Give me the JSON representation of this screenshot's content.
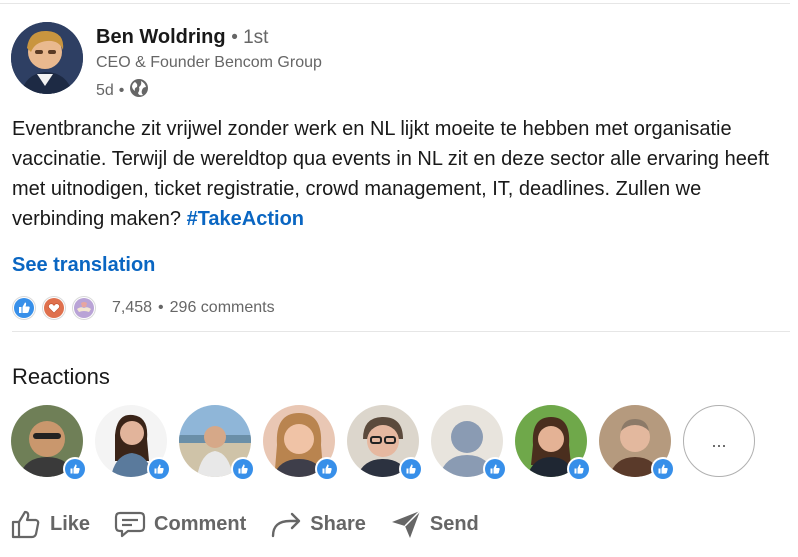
{
  "post": {
    "author_name": "Ben Woldring",
    "degree": "• 1st",
    "headline": "CEO & Founder Bencom Group",
    "age": "5d",
    "visibility_separator": "•",
    "visibility_icon": "globe-icon",
    "text": "Eventbranche zit vrijwel zonder werk en NL lijkt moeite te hebben met organisatie vaccinatie. Terwijl de wereldtop qua events in NL zit en deze sector alle ervaring heeft met uitnodigen, ticket registratie, crowd management, IT, deadlines. Zullen we verbinding maken?",
    "hashtag": "#TakeAction",
    "see_translation": "See translation"
  },
  "social": {
    "reaction_icons": [
      "like-icon",
      "love-icon",
      "support-icon"
    ],
    "reaction_count": "7,458",
    "separator": "•",
    "comments": "296 comments"
  },
  "reactions": {
    "title": "Reactions",
    "people": [
      {
        "name": "reactor-1",
        "badge": "like-icon"
      },
      {
        "name": "reactor-2",
        "badge": "like-icon"
      },
      {
        "name": "reactor-3",
        "badge": "like-icon"
      },
      {
        "name": "reactor-4",
        "badge": "like-icon"
      },
      {
        "name": "reactor-5",
        "badge": "like-icon"
      },
      {
        "name": "reactor-6",
        "badge": "like-icon"
      },
      {
        "name": "reactor-7",
        "badge": "like-icon"
      },
      {
        "name": "reactor-8",
        "badge": "like-icon"
      }
    ],
    "more_label": "..."
  },
  "actions": {
    "like": "Like",
    "comment": "Comment",
    "share": "Share",
    "send": "Send"
  },
  "colors": {
    "link_blue": "#0a66c2",
    "like_blue": "#378fe9",
    "love_red": "#df704d",
    "text_dark": "#191919",
    "text_muted": "#666666"
  }
}
